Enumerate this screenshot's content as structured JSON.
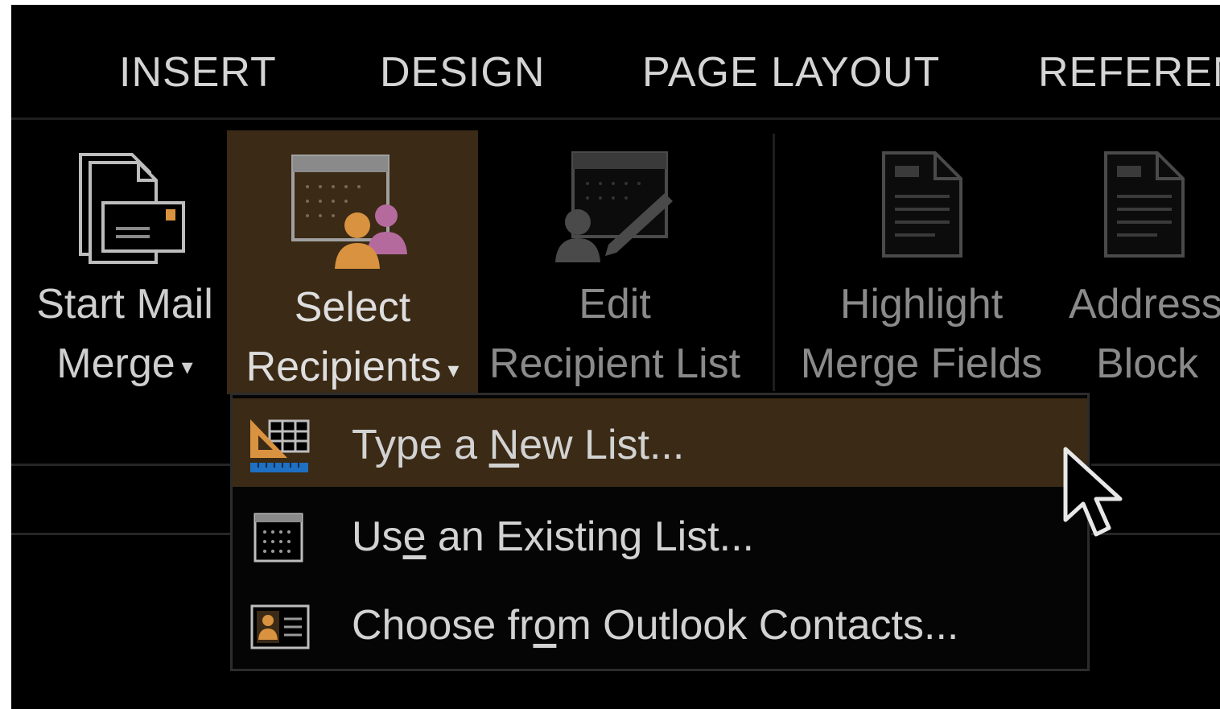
{
  "tabs": [
    {
      "label": "INSERT"
    },
    {
      "label": "DESIGN"
    },
    {
      "label": "PAGE LAYOUT"
    },
    {
      "label": "REFEREN"
    }
  ],
  "ribbon": {
    "start_mail_merge": {
      "line1": "Start Mail",
      "line2": "Merge",
      "icon": "envelope-document-icon"
    },
    "select_recipients": {
      "line1": "Select",
      "line2": "Recipients",
      "icon": "recipients-calendar-icon",
      "state": "open"
    },
    "edit_recipient_list": {
      "line1": "Edit",
      "line2": "Recipient List",
      "icon": "edit-list-icon",
      "state": "disabled"
    },
    "highlight_merge_fields": {
      "line1": "Highlight",
      "line2": "Merge Fields",
      "icon": "document-icon",
      "state": "disabled"
    },
    "address_block": {
      "line1": "Address",
      "line2": "Block",
      "icon": "address-document-icon",
      "state": "disabled"
    }
  },
  "menu": {
    "items": [
      {
        "pre": "Type a ",
        "accel": "N",
        "post": "ew List...",
        "icon": "new-list-icon",
        "highlighted": true
      },
      {
        "pre": "Us",
        "accel": "e",
        "post": " an Existing List...",
        "icon": "existing-list-icon"
      },
      {
        "pre": "Choose fr",
        "accel": "o",
        "post": "m Outlook Contacts...",
        "icon": "contact-card-icon"
      }
    ]
  },
  "colors": {
    "background": "#000000",
    "highlight": "#3b2a15",
    "accent_orange": "#d9923f",
    "accent_pink": "#b56a9e",
    "text": "#d2d2d2",
    "disabled_text": "#8a8a8a"
  }
}
